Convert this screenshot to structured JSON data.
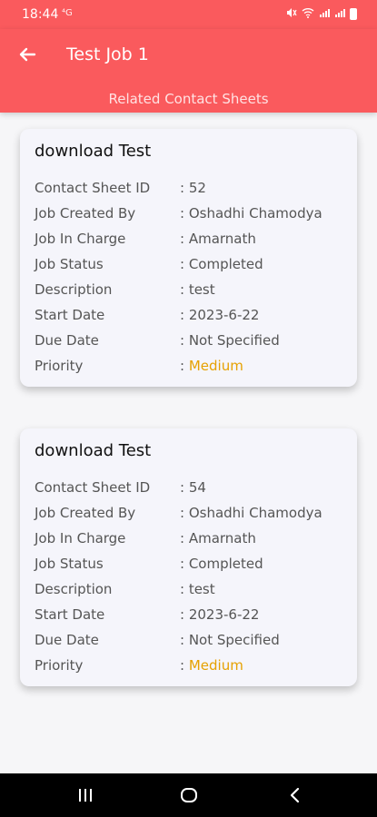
{
  "status_bar": {
    "time": "18:44",
    "network": "⁴G"
  },
  "header": {
    "title": "Test Job 1",
    "subtitle": "Related Contact Sheets"
  },
  "sheets": [
    {
      "title": "download Test",
      "rows": [
        {
          "label": "Contact Sheet ID",
          "value": ": 52"
        },
        {
          "label": "Job Created By",
          "value": ": Oshadhi Chamodya"
        },
        {
          "label": "Job In Charge",
          "value": ": Amarnath"
        },
        {
          "label": "Job Status",
          "value": ": Completed"
        },
        {
          "label": "Description",
          "value": ": test"
        },
        {
          "label": "Start Date",
          "value": ": 2023-6-22"
        },
        {
          "label": "Due Date",
          "value": ": Not Specified"
        },
        {
          "label": "Priority",
          "value": ": ",
          "priority": "Medium"
        }
      ]
    },
    {
      "title": "download Test",
      "rows": [
        {
          "label": "Contact Sheet ID",
          "value": ": 54"
        },
        {
          "label": "Job Created By",
          "value": ": Oshadhi Chamodya"
        },
        {
          "label": "Job In Charge",
          "value": ": Amarnath"
        },
        {
          "label": "Job Status",
          "value": ": Completed"
        },
        {
          "label": "Description",
          "value": ": test"
        },
        {
          "label": "Start Date",
          "value": ": 2023-6-22"
        },
        {
          "label": "Due Date",
          "value": ": Not Specified"
        },
        {
          "label": "Priority",
          "value": ": ",
          "priority": "Medium"
        }
      ]
    }
  ],
  "icons": {
    "back": "arrow-left-icon",
    "recents": "recents-icon",
    "home": "home-icon",
    "nav_back": "chevron-left-icon"
  },
  "colors": {
    "brand": "#fa5a5d",
    "priority_medium": "#e6a100"
  }
}
